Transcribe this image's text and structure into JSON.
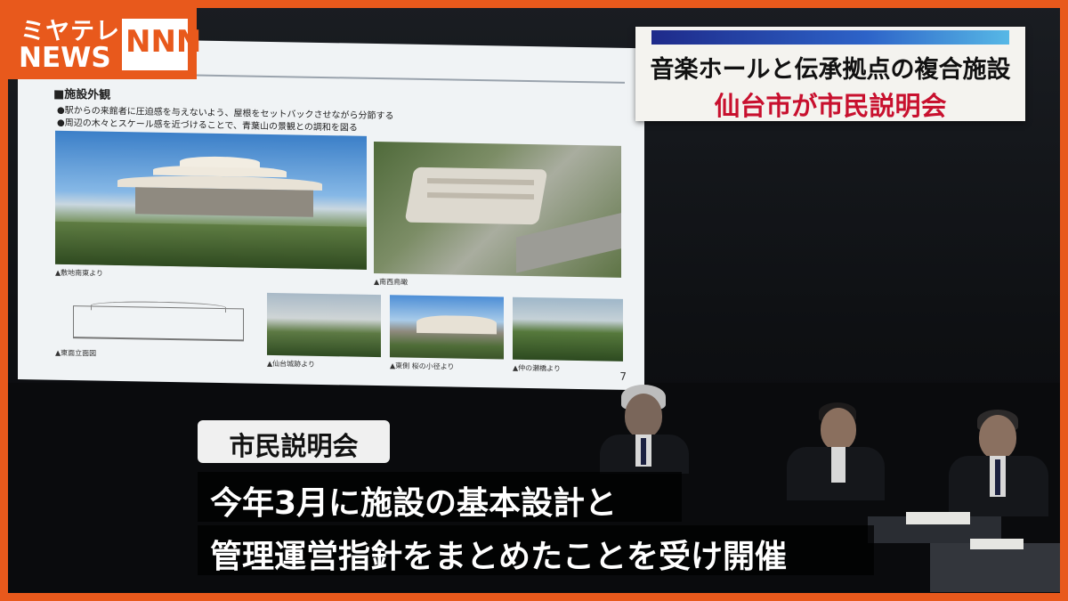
{
  "logo": {
    "line1": "ミヤテレ",
    "line2": "NEWS",
    "network": "NNN",
    "accent": "#e8591c"
  },
  "headline": {
    "line1": "音楽ホールと伝承拠点の複合施設",
    "line2": "仙台市が市民説明会",
    "line2_color": "#c8102e"
  },
  "slide": {
    "heading": "■施設外観",
    "bullets": [
      "●駅からの来館者に圧迫感を与えないよう、屋根をセットバックさせながら分節する",
      "●周辺の木々とスケール感を近づけることで、青葉山の景観との調和を図る"
    ],
    "captions": [
      "▲敷地南東より",
      "▲南西鳥瞰",
      "▲東面立面図",
      "▲仙台城跡より",
      "▲東側 桜の小径より",
      "▲仲の瀬橋より"
    ],
    "page_number": "7"
  },
  "caption": {
    "label": "市民説明会",
    "line1": "今年3月に施設の基本設計と",
    "line2": "管理運営指針をまとめたことを受け開催"
  }
}
